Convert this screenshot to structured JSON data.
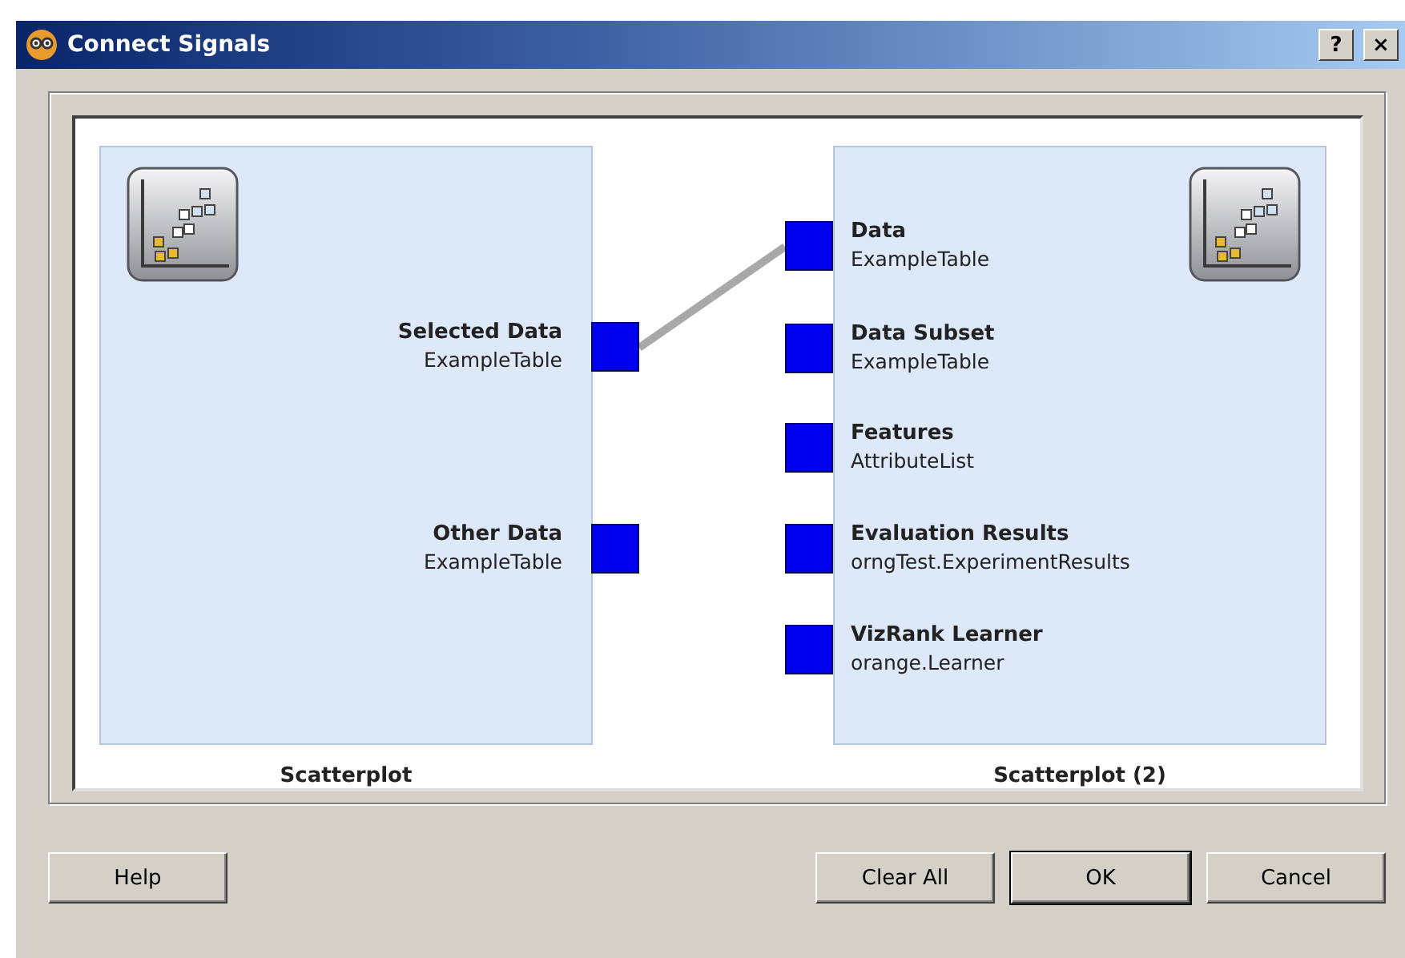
{
  "window": {
    "title": "Connect Signals",
    "title_buttons": [
      "?",
      "×"
    ]
  },
  "output_widget": {
    "name": "Scatterplot",
    "ports": [
      {
        "name": "Selected Data",
        "type": "ExampleTable",
        "connected": true
      },
      {
        "name": "Other Data",
        "type": "ExampleTable",
        "connected": false
      }
    ]
  },
  "input_widget": {
    "name": "Scatterplot (2)",
    "ports": [
      {
        "name": "Data",
        "type": "ExampleTable",
        "connected": true
      },
      {
        "name": "Data Subset",
        "type": "ExampleTable",
        "connected": false
      },
      {
        "name": "Features",
        "type": "AttributeList",
        "connected": false
      },
      {
        "name": "Evaluation Results",
        "type": "orngTest.ExperimentResults",
        "connected": false
      },
      {
        "name": "VizRank Learner",
        "type": "orange.Learner",
        "connected": false
      }
    ]
  },
  "buttons": [
    {
      "label": "Help",
      "kind": "plain"
    },
    {
      "label": "Clear All",
      "kind": "plain"
    },
    {
      "label": "OK",
      "kind": "default"
    },
    {
      "label": "Cancel",
      "kind": "plain"
    }
  ]
}
